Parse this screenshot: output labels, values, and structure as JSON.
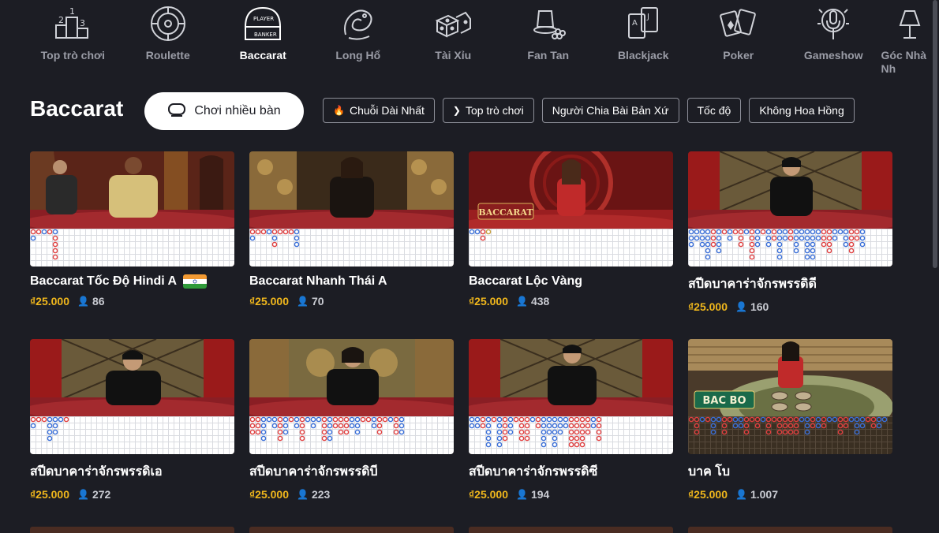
{
  "nav": {
    "items": [
      {
        "label": "Top trò chơi",
        "icon": "podium-icon",
        "active": false
      },
      {
        "label": "Roulette",
        "icon": "roulette-wheel-icon",
        "active": false
      },
      {
        "label": "Baccarat",
        "icon": "baccarat-table-icon",
        "active": true
      },
      {
        "label": "Long Hổ",
        "icon": "dragon-tiger-icon",
        "active": false
      },
      {
        "label": "Tài Xỉu",
        "icon": "dice-icon",
        "active": false
      },
      {
        "label": "Fan Tan",
        "icon": "fan-tan-icon",
        "active": false
      },
      {
        "label": "Blackjack",
        "icon": "blackjack-cards-icon",
        "active": false
      },
      {
        "label": "Poker",
        "icon": "poker-cards-icon",
        "active": false
      },
      {
        "label": "Gameshow",
        "icon": "microphone-icon",
        "active": false
      },
      {
        "label": "Góc Nhà Nh",
        "icon": "lamp-icon",
        "active": false
      }
    ]
  },
  "section": {
    "title": "Baccarat",
    "multi_table_label": "Chơi nhiều bàn"
  },
  "filters": [
    {
      "label": "Chuỗi Dài Nhất",
      "icon": "flame-icon"
    },
    {
      "label": "Top trò chơi",
      "icon": "chevron-right-icon"
    },
    {
      "label": "Người Chia Bài Bản Xứ",
      "icon": ""
    },
    {
      "label": "Tốc độ",
      "icon": ""
    },
    {
      "label": "Không Hoa Hồng",
      "icon": ""
    }
  ],
  "games": [
    {
      "name": "Baccarat Tốc Độ Hindi A",
      "price": "₫25.000",
      "players": "86",
      "flag": "india-flag"
    },
    {
      "name": "Baccarat Nhanh Thái A",
      "price": "₫25.000",
      "players": "70"
    },
    {
      "name": "Baccarat Lộc Vàng",
      "price": "₫25.000",
      "players": "438"
    },
    {
      "name": "สปีดบาคาร่าจักรพรรดิดี",
      "price": "₫25.000",
      "players": "160"
    },
    {
      "name": "สปีดบาคาร่าจักรพรรดิเอ",
      "price": "₫25.000",
      "players": "272"
    },
    {
      "name": "สปีดบาคาร่าจักรพรรดิบี",
      "price": "₫25.000",
      "players": "223"
    },
    {
      "name": "สปีดบาคาร่าจักรพรรดิซี",
      "price": "₫25.000",
      "players": "194"
    },
    {
      "name": "บาค โบ",
      "price": "₫25.000",
      "players": "1.007"
    }
  ],
  "colors": {
    "background": "#1c1d24",
    "price": "#f0b71c",
    "banker_red": "#e04040",
    "player_blue": "#3a6fd8"
  }
}
